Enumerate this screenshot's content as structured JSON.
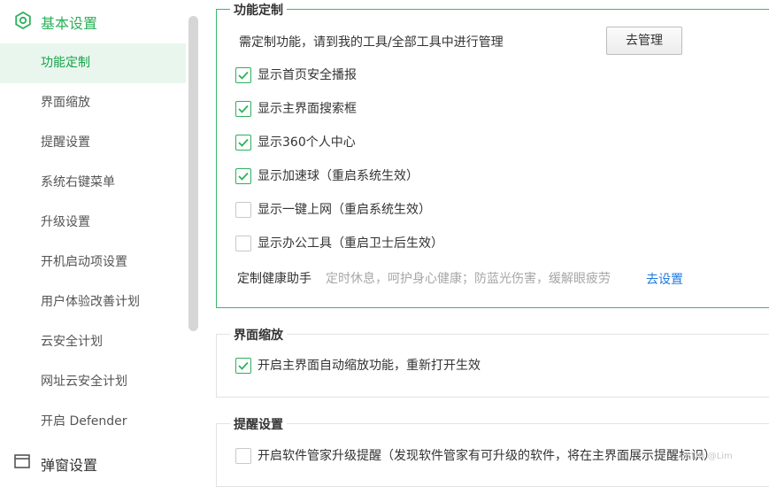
{
  "sidebar": {
    "header": "基本设置",
    "items": [
      {
        "label": "功能定制",
        "active": true
      },
      {
        "label": "界面缩放"
      },
      {
        "label": "提醒设置"
      },
      {
        "label": "系统右键菜单"
      },
      {
        "label": "升级设置"
      },
      {
        "label": "开机启动项设置"
      },
      {
        "label": "用户体验改善计划"
      },
      {
        "label": "云安全计划"
      },
      {
        "label": "网址云安全计划"
      },
      {
        "label": "开启 Defender"
      }
    ],
    "footer": "弹窗设置"
  },
  "sections": {
    "custom": {
      "title": "功能定制",
      "desc": "需定制功能，请到我的工具/全部工具中进行管理",
      "manage_button": "去管理",
      "options": [
        {
          "label": "显示首页安全播报",
          "checked": true
        },
        {
          "label": "显示主界面搜索框",
          "checked": true
        },
        {
          "label": "显示360个人中心",
          "checked": true
        },
        {
          "label": "显示加速球（重启系统生效）",
          "checked": true
        },
        {
          "label": "显示一键上网（重启系统生效）",
          "checked": false
        },
        {
          "label": "显示办公工具（重启卫士后生效）",
          "checked": false
        }
      ],
      "health_label": "定制健康助手",
      "health_hint": "定时休息，呵护身心健康；防蓝光伤害，缓解眼疲劳",
      "health_link": "去设置"
    },
    "zoom": {
      "title": "界面缩放",
      "option": {
        "label": "开启主界面自动缩放功能，重新打开生效",
        "checked": true
      }
    },
    "remind": {
      "title": "提醒设置",
      "option": {
        "label": "开启软件管家升级提醒（发现软件管家有可升级的软件，将在主界面展示提醒标识）",
        "checked": false
      }
    }
  },
  "watermark": "CSDN @Lim",
  "colors": {
    "accent": "#2bb15a",
    "link": "#1f7ae0",
    "active_bg": "#e9f6ee"
  }
}
